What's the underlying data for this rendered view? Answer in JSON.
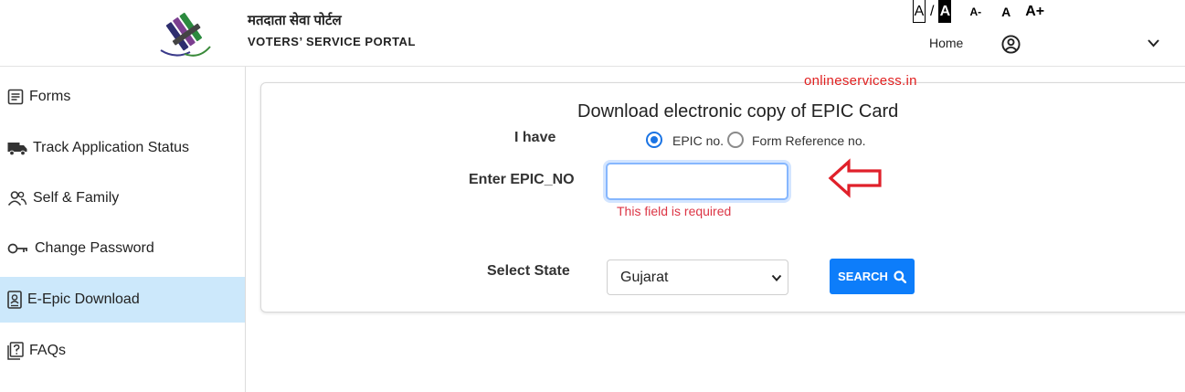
{
  "header": {
    "brand_hindi": "मतदाता सेवा पोर्टल",
    "brand_english": "VOTERS’ SERVICE PORTAL",
    "font_controls": {
      "a_default": "A",
      "slash": "/",
      "a_contrast": "A",
      "a_minus": "A-",
      "a_normal": "A",
      "a_plus": "A+"
    },
    "nav": {
      "home": "Home",
      "user_icon": "user-circle-icon",
      "dropdown_icon": "chevron-down-icon"
    }
  },
  "sidebar": {
    "items": [
      {
        "label": "Forms",
        "icon": "form-icon",
        "active": false
      },
      {
        "label": "Track Application Status",
        "icon": "truck-icon",
        "active": false
      },
      {
        "label": "Self & Family",
        "icon": "family-icon",
        "active": false
      },
      {
        "label": "Change Password",
        "icon": "key-icon",
        "active": false
      },
      {
        "label": "E-Epic Download",
        "icon": "id-card-icon",
        "active": true
      },
      {
        "label": "FAQs",
        "icon": "question-icon",
        "active": false
      }
    ]
  },
  "main": {
    "watermark": "onlineservicess.in",
    "title": "Download electronic copy of EPIC Card",
    "have_label": "I have",
    "radio_options": [
      {
        "label": "EPIC no.",
        "checked": true
      },
      {
        "label": "Form Reference no.",
        "checked": false
      }
    ],
    "epic_label": "Enter EPIC_NO",
    "epic_value": "",
    "epic_error": "This field is required",
    "state_label": "Select State",
    "state_selected": "Gujarat",
    "search_label": "SEARCH",
    "search_icon": "search-icon"
  },
  "colors": {
    "accent_blue": "#0d7dfa",
    "sidebar_active": "#cce8fb",
    "error_red": "#dc3545",
    "arrow_red": "#e0202a"
  }
}
